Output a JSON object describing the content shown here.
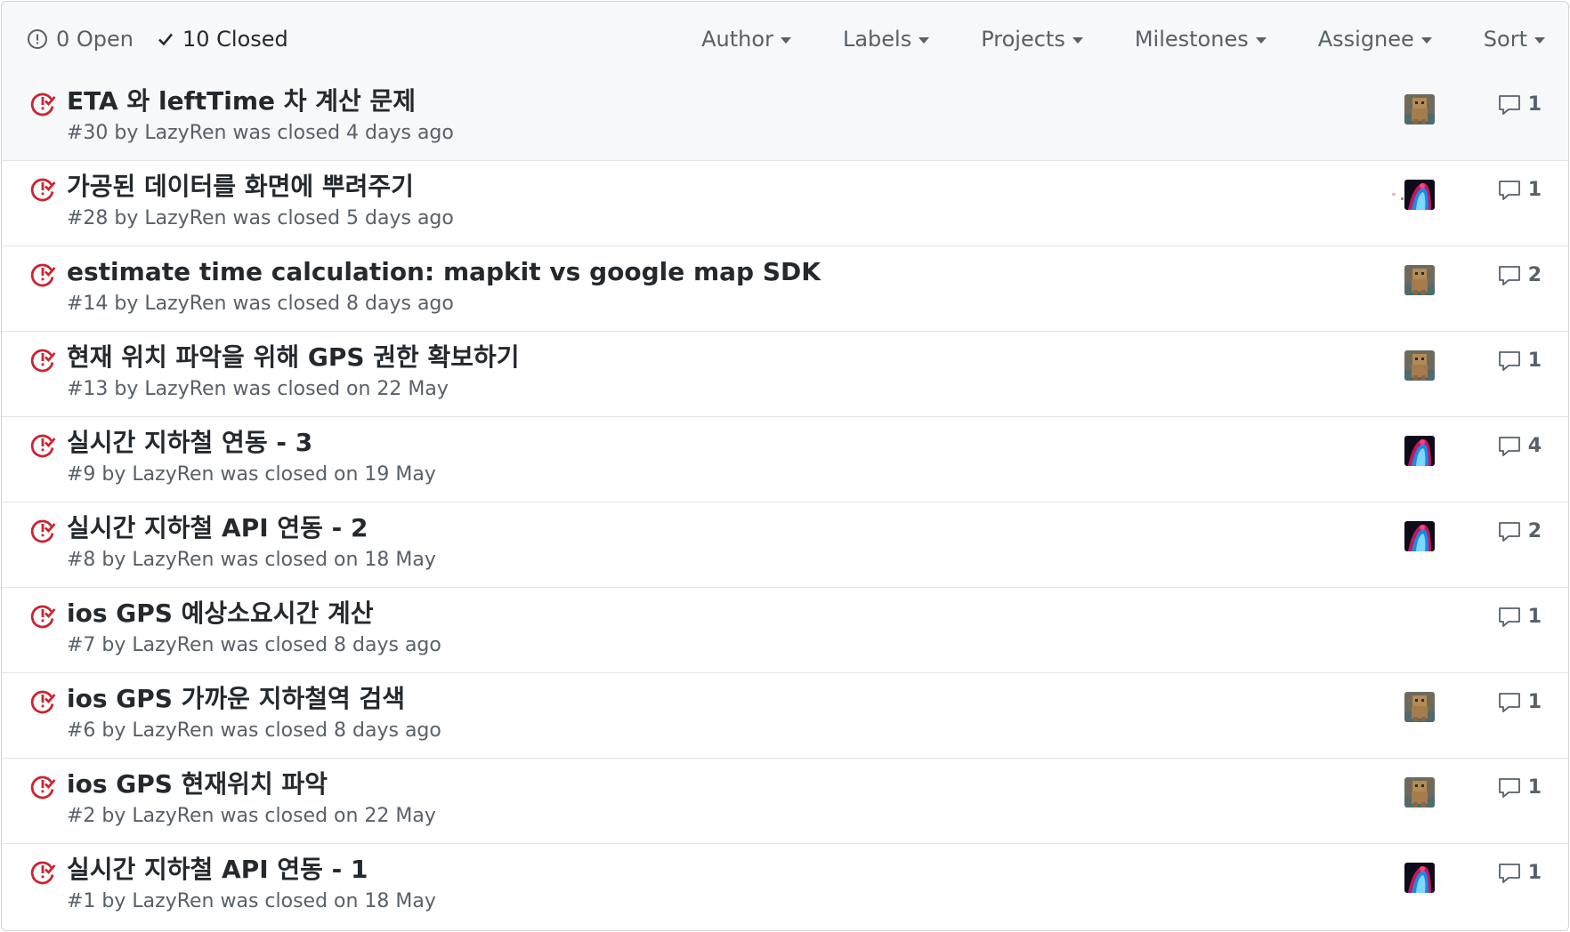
{
  "header": {
    "open_label": "0 Open",
    "closed_label": "10 Closed",
    "filters": [
      "Author",
      "Labels",
      "Projects",
      "Milestones",
      "Assignee",
      "Sort"
    ]
  },
  "issues": [
    {
      "title": "ETA 와 leftTime 차 계산 문제",
      "meta": "#30 by LazyRen was closed 4 days ago",
      "comments": "1",
      "assignees": [
        "robot"
      ]
    },
    {
      "title": "가공된 데이터를 화면에 뿌려주기",
      "meta": "#28 by LazyRen was closed 5 days ago",
      "comments": "1",
      "assignees": [
        "pixel",
        "neon"
      ]
    },
    {
      "title": "estimate time calculation: mapkit vs google map SDK",
      "meta": "#14 by LazyRen was closed 8 days ago",
      "comments": "2",
      "assignees": [
        "robot"
      ]
    },
    {
      "title": "현재 위치 파악을 위해 GPS 권한 확보하기",
      "meta": "#13 by LazyRen was closed on 22 May",
      "comments": "1",
      "assignees": [
        "robot"
      ]
    },
    {
      "title": "실시간 지하철 연동 - 3",
      "meta": "#9 by LazyRen was closed on 19 May",
      "comments": "4",
      "assignees": [
        "neon"
      ]
    },
    {
      "title": "실시간 지하철 API 연동 - 2",
      "meta": "#8 by LazyRen was closed on 18 May",
      "comments": "2",
      "assignees": [
        "neon"
      ]
    },
    {
      "title": "ios GPS 예상소요시간 계산",
      "meta": "#7 by LazyRen was closed 8 days ago",
      "comments": "1",
      "assignees": []
    },
    {
      "title": "ios GPS 가까운 지하철역 검색",
      "meta": "#6 by LazyRen was closed 8 days ago",
      "comments": "1",
      "assignees": [
        "robot"
      ]
    },
    {
      "title": "ios GPS 현재위치 파악",
      "meta": "#2 by LazyRen was closed on 22 May",
      "comments": "1",
      "assignees": [
        "robot"
      ]
    },
    {
      "title": "실시간 지하철 API 연동 - 1",
      "meta": "#1 by LazyRen was closed on 18 May",
      "comments": "1",
      "assignees": [
        "neon"
      ]
    }
  ],
  "colors": {
    "closed_icon": "#cb2431",
    "text_primary": "#24292e",
    "text_secondary": "#586069",
    "header_bg": "#f6f8fa",
    "border": "#e1e4e8"
  },
  "icons": {
    "open_state": "issue-opened-icon",
    "closed_state": "check-icon",
    "issue_closed": "issue-closed-icon",
    "comment": "comment-icon",
    "dropdown": "caret-down-icon"
  }
}
